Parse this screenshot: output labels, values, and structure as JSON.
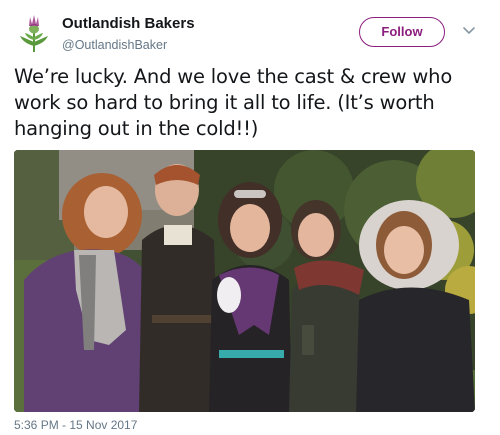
{
  "tweet": {
    "author": {
      "display_name": "Outlandish Bakers",
      "handle": "@OutlandishBaker",
      "avatar_icon": "thistle-icon"
    },
    "follow_label": "Follow",
    "menu_icon": "chevron-down-icon",
    "text": "We’re lucky. And we love the cast & crew who work so hard to bring it all to life. (It’s worth hanging out in the cold!!)",
    "timestamp": "5:36 PM - 15 Nov 2017"
  },
  "colors": {
    "accent": "#8b1e7e",
    "text_primary": "#14171a",
    "text_secondary": "#657786"
  }
}
